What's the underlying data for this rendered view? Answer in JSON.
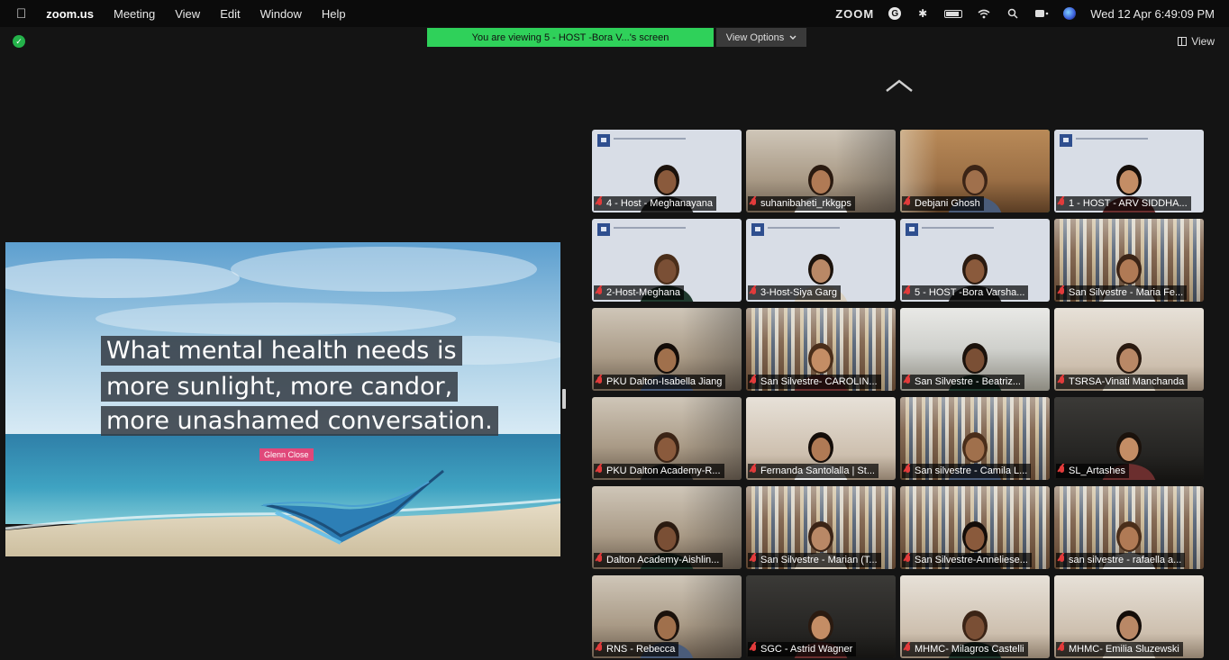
{
  "menubar": {
    "app": "zoom.us",
    "menus": [
      "Meeting",
      "View",
      "Edit",
      "Window",
      "Help"
    ],
    "status_logo": "ZOOM",
    "g_letter": "G",
    "datetime": "Wed 12 Apr  6:49:09 PM"
  },
  "banner": {
    "viewing_text": "You are viewing 5 - HOST -Bora  V...'s screen",
    "view_options_label": "View Options",
    "view_label": "View"
  },
  "shared_screen": {
    "quote_lines": [
      "What mental health needs is",
      "more sunlight, more candor,",
      "more unashamed conversation."
    ],
    "author": "Glenn Close"
  },
  "participants": [
    {
      "name": "4 - Host - Meghanayana",
      "bg": "slide"
    },
    {
      "name": "suhanibaheti_rkkgps",
      "bg": "room"
    },
    {
      "name": "Debjani Ghosh",
      "bg": "warm",
      "active": true
    },
    {
      "name": "1 - HOST - ARV SIDDHA...",
      "bg": "slide"
    },
    {
      "name": "2-Host-Meghana",
      "bg": "slide"
    },
    {
      "name": "3-Host-Siya Garg",
      "bg": "slide"
    },
    {
      "name": "5 - HOST -Bora  Varsha...",
      "bg": "slide"
    },
    {
      "name": "San Silvestre - Maria Fe...",
      "bg": "library"
    },
    {
      "name": "PKU Dalton-Isabella Jiang",
      "bg": "room"
    },
    {
      "name": "San Silvestre- CAROLIN...",
      "bg": "library"
    },
    {
      "name": "San Silvestre - Beatriz...",
      "bg": "office"
    },
    {
      "name": "TSRSA-Vinati Manchanda",
      "bg": "wall"
    },
    {
      "name": "PKU Dalton Academy-R...",
      "bg": "room"
    },
    {
      "name": "Fernanda Santolalla | St...",
      "bg": "wall"
    },
    {
      "name": "San silvestre - Camila L...",
      "bg": "library"
    },
    {
      "name": "SL_Artashes",
      "bg": "dark"
    },
    {
      "name": "Dalton Academy-Aishlin...",
      "bg": "room"
    },
    {
      "name": "San Silvestre - Marian (T...",
      "bg": "library"
    },
    {
      "name": "San Silvestre-Anneliese...",
      "bg": "library"
    },
    {
      "name": "san silvestre - rafaella a...",
      "bg": "library"
    },
    {
      "name": "RNS - Rebecca",
      "bg": "room"
    },
    {
      "name": "SGC - Astrid Wagner",
      "bg": "dark"
    },
    {
      "name": "MHMC- Milagros Castelli",
      "bg": "wall"
    },
    {
      "name": "MHMC- Emilia Sluzewski",
      "bg": "wall"
    }
  ],
  "colors": {
    "banner_green": "#2fd15a",
    "muted_mic_red": "#e23b3b",
    "active_speaker_border": "#2fd15a"
  }
}
